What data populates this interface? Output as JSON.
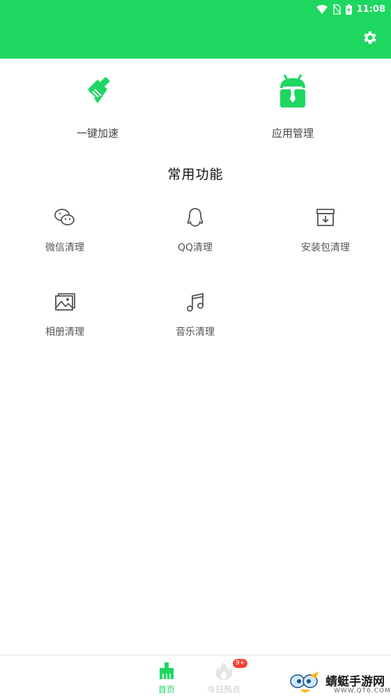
{
  "status_bar": {
    "time": "11:08"
  },
  "header": {
    "settings_icon": "gear-icon"
  },
  "quick_actions": [
    {
      "label": "一键加速",
      "icon": "broom-icon"
    },
    {
      "label": "应用管理",
      "icon": "android-manager-icon"
    }
  ],
  "section": {
    "title": "常用功能"
  },
  "functions": [
    {
      "label": "微信清理",
      "icon": "wechat-icon"
    },
    {
      "label": "QQ清理",
      "icon": "qq-icon"
    },
    {
      "label": "安装包清理",
      "icon": "package-icon"
    },
    {
      "label": "相册清理",
      "icon": "photo-icon"
    },
    {
      "label": "音乐清理",
      "icon": "music-icon"
    }
  ],
  "tabs": [
    {
      "label": "首页",
      "icon": "broom-icon",
      "active": true
    },
    {
      "label": "今日热点",
      "icon": "flame-icon",
      "badge": "9+"
    }
  ],
  "watermark": {
    "text": "蜻蜓手游网",
    "url": "WWW.QT6.COM"
  },
  "colors": {
    "accent": "#1ed760",
    "badge": "#f44336"
  }
}
